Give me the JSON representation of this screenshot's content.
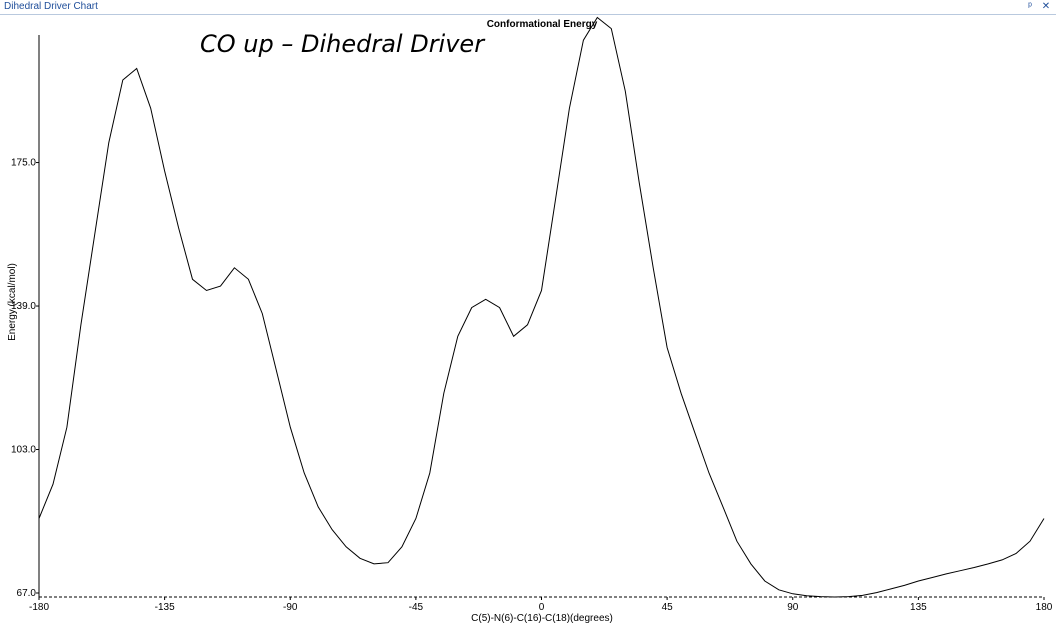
{
  "window": {
    "title": "Dihedral Driver Chart",
    "pin_icon": "pin-icon",
    "close_icon": "close-icon",
    "pin_glyph": "ᵖ",
    "close_glyph": "✕"
  },
  "annotation": "CO up – Dihedral Driver",
  "chart_data": {
    "type": "line",
    "title": "Conformational Energy",
    "xlabel": "C(5)-N(6)-C(16)-C(18)(degrees)",
    "ylabel": "Energy (kcal/mol)",
    "xlim": [
      -180,
      180
    ],
    "ylim": [
      67,
      207
    ],
    "xticks": [
      -180,
      -135,
      -90,
      -45,
      0,
      45,
      90,
      135,
      180
    ],
    "xtick_labels": [
      "-180",
      "-135",
      "-90",
      "-45",
      "0",
      "45",
      "90",
      "135",
      "180"
    ],
    "yticks": [
      67,
      103,
      139,
      175
    ],
    "ytick_labels": [
      "67.0",
      "103.0",
      "139.0",
      "175.0"
    ],
    "grid": false,
    "line_color": "#000000",
    "baseline": {
      "y": 66,
      "style": "dashed"
    },
    "series": [
      {
        "x": [
          -180,
          -175,
          -170,
          -165,
          -160,
          -155,
          -150,
          -145,
          -140,
          -135,
          -130,
          -125,
          -120,
          -115,
          -110,
          -105,
          -100,
          -95,
          -90,
          -85,
          -80,
          -75,
          -70,
          -65,
          -60,
          -55,
          -50,
          -45,
          -40,
          -35,
          -30,
          -25,
          -20,
          -15,
          -10,
          -5,
          0,
          5,
          10,
          15,
          20,
          25,
          30,
          35,
          40,
          45,
          50,
          55,
          60,
          65,
          70,
          75,
          80,
          85,
          90,
          95,
          100,
          105,
          110,
          115,
          120,
          125,
          130,
          135,
          140,
          145,
          150,
          155,
          160,
          165,
          170,
          175,
          180
        ],
        "y": [
          85.7,
          94.3,
          108.6,
          134.3,
          157.1,
          180.0,
          195.7,
          198.6,
          188.6,
          172.9,
          158.6,
          145.7,
          142.9,
          144.0,
          148.6,
          145.7,
          137.1,
          122.9,
          108.6,
          97.1,
          88.6,
          82.9,
          78.6,
          75.7,
          74.3,
          74.6,
          78.6,
          85.7,
          97.1,
          117.1,
          131.4,
          138.6,
          140.7,
          138.6,
          131.4,
          134.3,
          142.9,
          165.7,
          188.6,
          205.7,
          211.4,
          208.6,
          192.9,
          170.0,
          148.6,
          128.6,
          117.1,
          107.1,
          97.1,
          88.6,
          80.0,
          74.3,
          70.0,
          67.8,
          66.8,
          66.3,
          66.1,
          66.0,
          66.1,
          66.4,
          67.1,
          68.0,
          68.9,
          70.0,
          70.9,
          71.8,
          72.6,
          73.4,
          74.3,
          75.3,
          76.9,
          80.0,
          85.7
        ]
      }
    ]
  }
}
